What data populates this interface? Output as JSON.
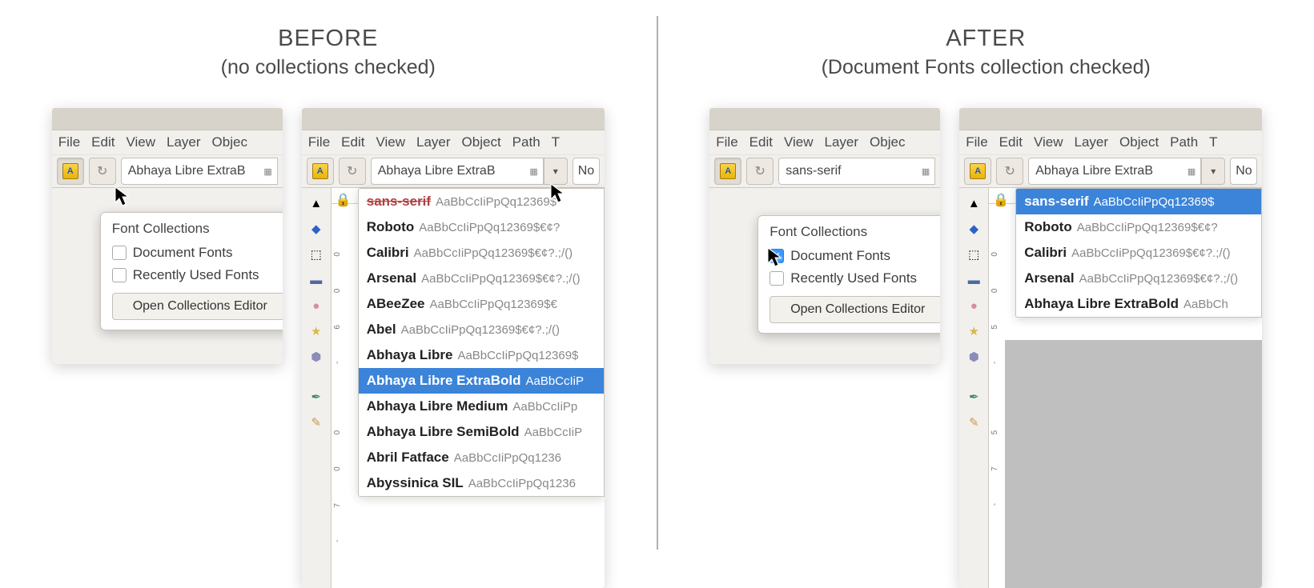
{
  "before": {
    "title": "BEFORE",
    "subtitle": "(no collections checked)",
    "menubar": [
      "File",
      "Edit",
      "View",
      "Layer",
      "Objec"
    ],
    "menubar_full": [
      "File",
      "Edit",
      "View",
      "Layer",
      "Object",
      "Path",
      "T"
    ],
    "font_input_small": "Abhaya Libre ExtraB",
    "font_input_large": "Abhaya Libre ExtraB",
    "style_hint": "No",
    "ruler_marks": [
      "-700",
      "-600"
    ],
    "popover": {
      "heading": "Font Collections",
      "opt1": "Document Fonts",
      "opt2": "Recently Used Fonts",
      "button": "Open Collections Editor",
      "opt1_checked": false,
      "opt2_checked": false
    },
    "font_list": [
      {
        "name": "sans-serif",
        "sample": "AaBbCcIiPpQq12369$",
        "strike": true,
        "selected": false
      },
      {
        "name": "Roboto",
        "sample": "AaBbCcIiPpQq12369$€¢?"
      },
      {
        "name": "Calibri",
        "sample": "AaBbCcIiPpQq12369$€¢?.;/()"
      },
      {
        "name": "Arsenal",
        "sample": "AaBbCcIiPpQq12369$€¢?.;/()"
      },
      {
        "name": "ABeeZee",
        "sample": "AaBbCcIiPpQq12369$€"
      },
      {
        "name": "Abel",
        "sample": "AaBbCcIiPpQq12369$€¢?.;/()"
      },
      {
        "name": "Abhaya Libre",
        "sample": "AaBbCcIiPpQq12369$"
      },
      {
        "name": "Abhaya Libre ExtraBold",
        "sample": "AaBbCcIiP",
        "selected": true
      },
      {
        "name": "Abhaya Libre Medium",
        "sample": "AaBbCcIiPp"
      },
      {
        "name": "Abhaya Libre SemiBold",
        "sample": "AaBbCcIiP"
      },
      {
        "name": "Abril Fatface",
        "sample": "AaBbCcIiPpQq1236"
      },
      {
        "name": "Abyssinica SIL",
        "sample": "AaBbCcIiPpQq1236"
      }
    ]
  },
  "after": {
    "title": "AFTER",
    "subtitle": "(Document Fonts collection checked)",
    "menubar": [
      "File",
      "Edit",
      "View",
      "Layer",
      "Objec"
    ],
    "menubar_full": [
      "File",
      "Edit",
      "View",
      "Layer",
      "Object",
      "Path",
      "T"
    ],
    "font_input_small": "sans-serif",
    "font_input_large": "Abhaya Libre ExtraB",
    "style_hint": "No",
    "ruler_marks": [
      "-75",
      "-500"
    ],
    "popover": {
      "heading": "Font Collections",
      "opt1": "Document Fonts",
      "opt2": "Recently Used Fonts",
      "button": "Open Collections Editor",
      "opt1_checked": true,
      "opt2_checked": false
    },
    "font_list": [
      {
        "name": "sans-serif",
        "sample": "AaBbCcIiPpQq12369$",
        "selected": true
      },
      {
        "name": "Roboto",
        "sample": "AaBbCcIiPpQq12369$€¢?"
      },
      {
        "name": "Calibri",
        "sample": "AaBbCcIiPpQq12369$€¢?.;/()"
      },
      {
        "name": "Arsenal",
        "sample": "AaBbCcIiPpQq12369$€¢?.;/()"
      },
      {
        "name": "Abhaya Libre ExtraBold",
        "sample": "AaBbCh"
      }
    ]
  }
}
